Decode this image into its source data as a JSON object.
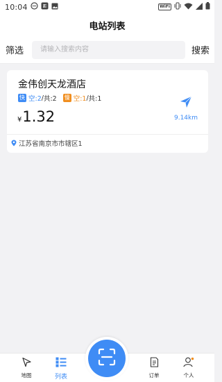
{
  "status_bar": {
    "time": "10:04",
    "wifi_badge": "WiFi",
    "icons": [
      "notification-icon",
      "app-icon",
      "image-icon",
      "vibrate-icon",
      "wifi-icon",
      "signal-icon",
      "battery-icon"
    ]
  },
  "header": {
    "title": "电站列表"
  },
  "search": {
    "filter_label": "筛选",
    "placeholder": "请输入搜索内容",
    "value": "",
    "search_label": "搜索"
  },
  "stations": [
    {
      "name": "金伟创天龙酒店",
      "fast": {
        "tag": "快",
        "free": "空:2",
        "sep": "/",
        "total": "共:2"
      },
      "slow": {
        "tag": "慢",
        "free": "空:1",
        "sep": "/",
        "total": "共:1"
      },
      "currency": "¥",
      "price": "1.32",
      "distance": "9.14km",
      "address": "江苏省南京市市辖区1"
    }
  ],
  "bottom_nav": {
    "items": [
      {
        "label": "地图",
        "icon": "map-arrow-icon"
      },
      {
        "label": "列表",
        "icon": "list-icon"
      },
      {
        "label": "订单",
        "icon": "order-icon"
      },
      {
        "label": "个人",
        "icon": "person-icon"
      }
    ],
    "scan_icon": "scan-icon"
  },
  "colors": {
    "accent": "#3f8cf5",
    "slow": "#f08e1f",
    "background": "#f2f2f4"
  }
}
